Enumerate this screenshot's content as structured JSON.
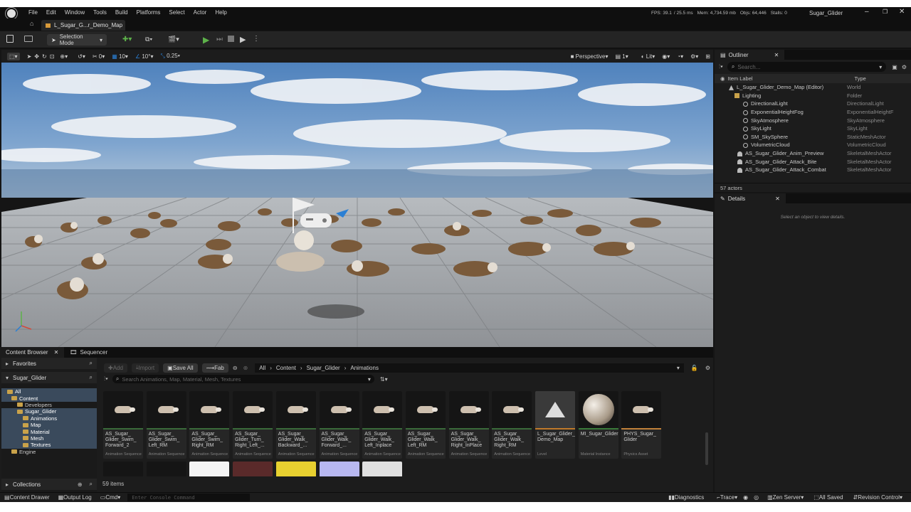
{
  "window": {
    "menu": [
      "File",
      "Edit",
      "Window",
      "Tools",
      "Build",
      "Platforms",
      "Select",
      "Actor",
      "Help"
    ],
    "stats": {
      "fps": "FPS: 39.1",
      "ms": "/ 25.5 ms",
      "mem": "Mem: 4,734.59 mb",
      "objs": "Objs: 64,446",
      "stalls": "Stalls: 0"
    },
    "project": "Sugar_Glider"
  },
  "tab": {
    "map": "L_Sugar_G...r_Demo_Map"
  },
  "toolbar": {
    "mode": "Selection Mode"
  },
  "viewport": {
    "snap_rot": "0",
    "grid": "10",
    "angle": "10°",
    "scale": "0.25",
    "perspective": "Perspective",
    "cams": "1",
    "lit": "Lit"
  },
  "outliner": {
    "title": "Outliner",
    "search_placeholder": "Search...",
    "col_label": "Item Label",
    "col_type": "Type",
    "count": "57 actors",
    "rows": [
      {
        "label": "L_Sugar_Glider_Demo_Map (Editor)",
        "type": "World",
        "indent": 20
      },
      {
        "label": "Lighting",
        "type": "Folder",
        "indent": 28
      },
      {
        "label": "DirectionalLight",
        "type": "DirectionalLight",
        "indent": 40
      },
      {
        "label": "ExponentialHeightFog",
        "type": "ExponentialHeightF",
        "indent": 40
      },
      {
        "label": "SkyAtmosphere",
        "type": "SkyAtmosphere",
        "indent": 40
      },
      {
        "label": "SkyLight",
        "type": "SkyLight",
        "indent": 40
      },
      {
        "label": "SM_SkySphere",
        "type": "StaticMeshActor",
        "indent": 40
      },
      {
        "label": "VolumetricCloud",
        "type": "VolumetricCloud",
        "indent": 40
      },
      {
        "label": "AS_Sugar_Glider_Anim_Preview",
        "type": "SkeletalMeshActor",
        "indent": 32
      },
      {
        "label": "AS_Sugar_Glider_Attack_Bite",
        "type": "SkeletalMeshActor",
        "indent": 32
      },
      {
        "label": "AS_Sugar_Glider_Attack_Combat",
        "type": "SkeletalMeshActor",
        "indent": 32
      }
    ]
  },
  "details": {
    "title": "Details",
    "hint": "Select an object to view details."
  },
  "content_browser": {
    "tab": "Content Browser",
    "sequencer": "Sequencer",
    "favorites": "Favorites",
    "root": "Sugar_Glider",
    "add": "Add",
    "import": "Import",
    "save_all": "Save All",
    "fab": "Fab",
    "path": [
      "All",
      "Content",
      "Sugar_Glider",
      "Animations"
    ],
    "search_placeholder": "Search Animations, Map, Material, Mesh, Textures",
    "count": "59 items",
    "collections": "Collections",
    "tree": [
      {
        "label": "All",
        "indent": 8,
        "sel": true
      },
      {
        "label": "Content",
        "indent": 14,
        "sel": true
      },
      {
        "label": "Developers",
        "indent": 22,
        "sel": false
      },
      {
        "label": "Sugar_Glider",
        "indent": 22,
        "sel": true
      },
      {
        "label": "Animations",
        "indent": 30,
        "sel": true
      },
      {
        "label": "Map",
        "indent": 30,
        "sel": true
      },
      {
        "label": "Material",
        "indent": 30,
        "sel": true
      },
      {
        "label": "Mesh",
        "indent": 30,
        "sel": true
      },
      {
        "label": "Textures",
        "indent": 30,
        "sel": true
      },
      {
        "label": "Engine",
        "indent": 14,
        "sel": false
      }
    ],
    "assets": [
      {
        "name": "AS_Sugar_\nGlider_Swim_\nForward_2",
        "type": "Animation Sequence",
        "strip": "#3a6a3a"
      },
      {
        "name": "AS_Sugar_\nGlider_Swim_\nLeft_RM",
        "type": "Animation Sequence",
        "strip": "#3a6a3a"
      },
      {
        "name": "AS_Sugar_\nGlider_Swim_\nRight_RM",
        "type": "Animation Sequence",
        "strip": "#3a6a3a"
      },
      {
        "name": "AS_Sugar_\nGlider_Turn_\nRight_Left_...",
        "type": "Animation Sequence",
        "strip": "#3a6a3a"
      },
      {
        "name": "AS_Sugar_\nGlider_Walk_\nBackward_...",
        "type": "Animation Sequence",
        "strip": "#3a6a3a"
      },
      {
        "name": "AS_Sugar_\nGlider_Walk_\nForward_...",
        "type": "Animation Sequence",
        "strip": "#3a6a3a"
      },
      {
        "name": "AS_Sugar_\nGlider_Walk_\nLeft_Inplace",
        "type": "Animation Sequence",
        "strip": "#3a6a3a"
      },
      {
        "name": "AS_Sugar_\nGlider_Walk_\nLeft_RM",
        "type": "Animation Sequence",
        "strip": "#3a6a3a"
      },
      {
        "name": "AS_Sugar_\nGlider_Walk_\nRight_InPlace",
        "type": "Animation Sequence",
        "strip": "#3a6a3a"
      },
      {
        "name": "AS_Sugar_\nGlider_Walk_\nRight_RM",
        "type": "Animation Sequence",
        "strip": "#3a6a3a"
      },
      {
        "name": "L_Sugar_Glider_\nDemo_Map",
        "type": "Level",
        "strip": "#c07a2a"
      },
      {
        "name": "MI_Sugar_Glider",
        "type": "Material Instance",
        "strip": "#3a7a3a"
      },
      {
        "name": "PHYS_Sugar_\nGlider",
        "type": "Physics Asset",
        "strip": "#c0803a"
      }
    ]
  },
  "status": {
    "drawer": "Content Drawer",
    "output": "Output Log",
    "cmd": "Cmd",
    "console_placeholder": "Enter Console Command",
    "diagnostics": "Diagnostics",
    "trace": "Trace",
    "zen": "Zen Server",
    "saved": "All Saved",
    "rc": "Revision Control"
  },
  "colors": {
    "accent": "#2a7fd4",
    "play": "#5db24a",
    "folder": "#c9a24a"
  }
}
